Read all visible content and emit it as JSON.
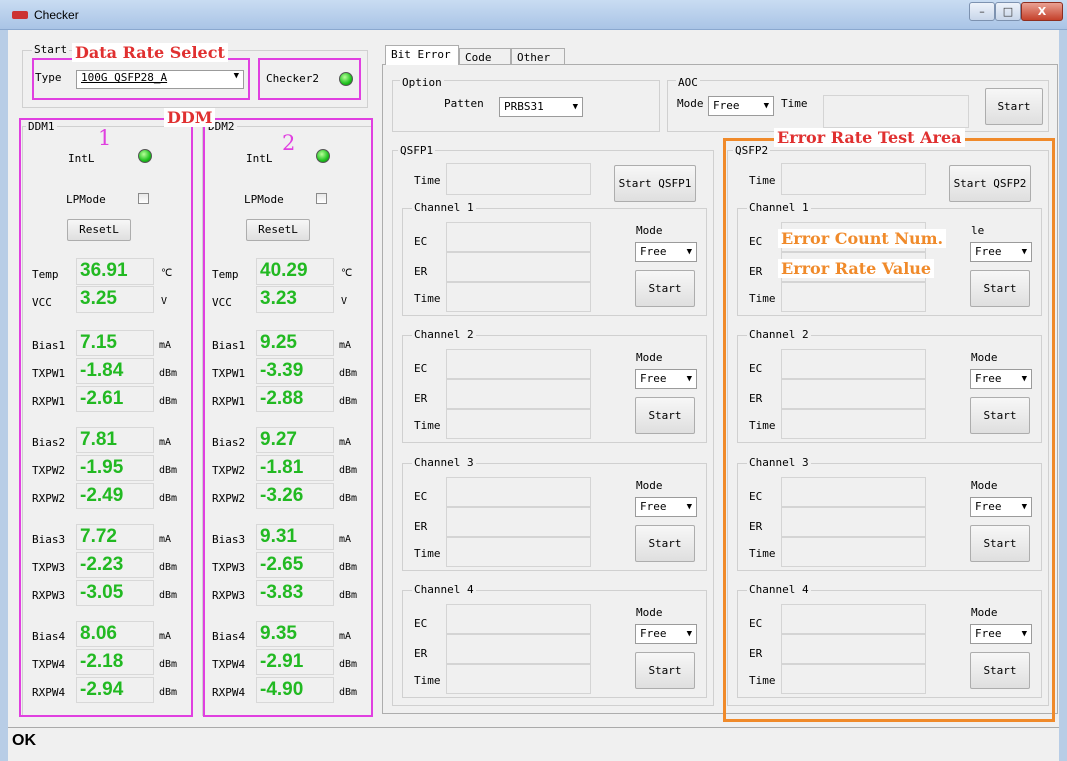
{
  "window": {
    "title": "Checker",
    "minimize": "–",
    "maximize": "□",
    "close": "X"
  },
  "start": {
    "group_label": "Start",
    "type_label": "Type",
    "type_value": "100G QSFP28_A",
    "checker2_label": "Checker2",
    "led_color": "#1fc21f"
  },
  "ddm": [
    {
      "group_label": "DDM1",
      "intl_label": "IntL",
      "lpmode_label": "LPMode",
      "resetl_label": "ResetL",
      "temp_label": "Temp",
      "temp": "36.91",
      "temp_unit": "℃",
      "vcc_label": "VCC",
      "vcc": "3.25",
      "vcc_unit": "V",
      "rows": [
        {
          "label": "Bias1",
          "value": "7.15",
          "unit": "mA"
        },
        {
          "label": "TXPW1",
          "value": "-1.84",
          "unit": "dBm"
        },
        {
          "label": "RXPW1",
          "value": "-2.61",
          "unit": "dBm"
        },
        {
          "label": "Bias2",
          "value": "7.81",
          "unit": "mA"
        },
        {
          "label": "TXPW2",
          "value": "-1.95",
          "unit": "dBm"
        },
        {
          "label": "RXPW2",
          "value": "-2.49",
          "unit": "dBm"
        },
        {
          "label": "Bias3",
          "value": "7.72",
          "unit": "mA"
        },
        {
          "label": "TXPW3",
          "value": "-2.23",
          "unit": "dBm"
        },
        {
          "label": "RXPW3",
          "value": "-3.05",
          "unit": "dBm"
        },
        {
          "label": "Bias4",
          "value": "8.06",
          "unit": "mA"
        },
        {
          "label": "TXPW4",
          "value": "-2.18",
          "unit": "dBm"
        },
        {
          "label": "RXPW4",
          "value": "-2.94",
          "unit": "dBm"
        }
      ]
    },
    {
      "group_label": "DDM2",
      "intl_label": "IntL",
      "lpmode_label": "LPMode",
      "resetl_label": "ResetL",
      "temp_label": "Temp",
      "temp": "40.29",
      "temp_unit": "℃",
      "vcc_label": "VCC",
      "vcc": "3.23",
      "vcc_unit": "V",
      "rows": [
        {
          "label": "Bias1",
          "value": "9.25",
          "unit": "mA"
        },
        {
          "label": "TXPW1",
          "value": "-3.39",
          "unit": "dBm"
        },
        {
          "label": "RXPW1",
          "value": "-2.88",
          "unit": "dBm"
        },
        {
          "label": "Bias2",
          "value": "9.27",
          "unit": "mA"
        },
        {
          "label": "TXPW2",
          "value": "-1.81",
          "unit": "dBm"
        },
        {
          "label": "RXPW2",
          "value": "-3.26",
          "unit": "dBm"
        },
        {
          "label": "Bias3",
          "value": "9.31",
          "unit": "mA"
        },
        {
          "label": "TXPW3",
          "value": "-2.65",
          "unit": "dBm"
        },
        {
          "label": "RXPW3",
          "value": "-3.83",
          "unit": "dBm"
        },
        {
          "label": "Bias4",
          "value": "9.35",
          "unit": "mA"
        },
        {
          "label": "TXPW4",
          "value": "-2.91",
          "unit": "dBm"
        },
        {
          "label": "RXPW4",
          "value": "-4.90",
          "unit": "dBm"
        }
      ]
    }
  ],
  "tabs": [
    "Bit Error",
    "Code",
    "Other"
  ],
  "option": {
    "group_label": "Option",
    "pattern_label": "Patten",
    "pattern_value": "PRBS31"
  },
  "aoc": {
    "group_label": "AOC",
    "mode_label": "Mode",
    "mode_value": "Free",
    "time_label": "Time",
    "start_label": "Start"
  },
  "qsfp": [
    {
      "group_label": "QSFP1",
      "time_label": "Time",
      "start_label": "Start QSFP1",
      "channels": [
        {
          "label": "Channel 1",
          "ec": "EC",
          "er": "ER",
          "time": "Time",
          "mode_label": "Mode",
          "mode_value": "Free",
          "start": "Start"
        },
        {
          "label": "Channel 2",
          "ec": "EC",
          "er": "ER",
          "time": "Time",
          "mode_label": "Mode",
          "mode_value": "Free",
          "start": "Start"
        },
        {
          "label": "Channel 3",
          "ec": "EC",
          "er": "ER",
          "time": "Time",
          "mode_label": "Mode",
          "mode_value": "Free",
          "start": "Start"
        },
        {
          "label": "Channel 4",
          "ec": "EC",
          "er": "ER",
          "time": "Time",
          "mode_label": "Mode",
          "mode_value": "Free",
          "start": "Start"
        }
      ]
    },
    {
      "group_label": "QSFP2",
      "time_label": "Time",
      "start_label": "Start QSFP2",
      "channels": [
        {
          "label": "Channel 1",
          "ec": "EC",
          "er": "ER",
          "time": "Time",
          "mode_label": "le",
          "mode_value": "Free",
          "start": "Start"
        },
        {
          "label": "Channel 2",
          "ec": "EC",
          "er": "ER",
          "time": "Time",
          "mode_label": "Mode",
          "mode_value": "Free",
          "start": "Start"
        },
        {
          "label": "Channel 3",
          "ec": "EC",
          "er": "ER",
          "time": "Time",
          "mode_label": "Mode",
          "mode_value": "Free",
          "start": "Start"
        },
        {
          "label": "Channel 4",
          "ec": "EC",
          "er": "ER",
          "time": "Time",
          "mode_label": "Mode",
          "mode_value": "Free",
          "start": "Start"
        }
      ]
    }
  ],
  "annotations": {
    "data_rate": "Data Rate Select",
    "ddm": "DDM",
    "num1": "1",
    "num2": "2",
    "error_area": "Error Rate Test Area",
    "error_count": "Error Count Num.",
    "error_rate": "Error Rate Value",
    "pink_color": "#e040e0",
    "orange_color": "#f08a2a",
    "red_color": "#e03030"
  },
  "status": "OK"
}
